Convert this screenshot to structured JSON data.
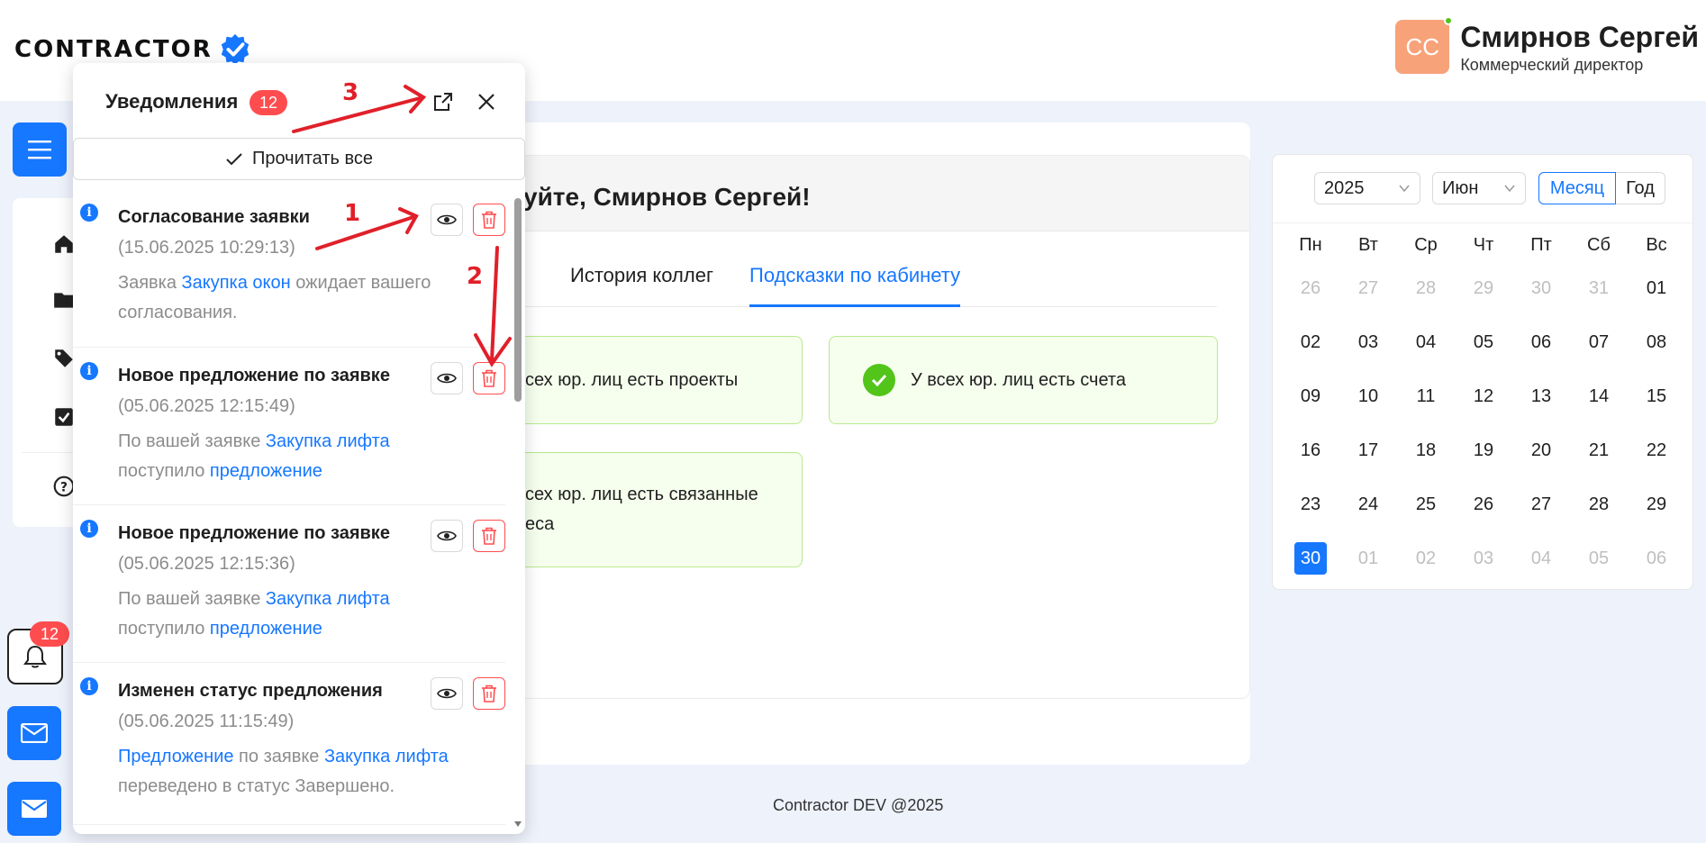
{
  "header": {
    "logo_text": "CONTRACTOR",
    "user_initials": "СС",
    "user_name": "Смирнов Сергей",
    "user_role": "Коммерческий директор"
  },
  "main": {
    "welcome_title": "уйте, Смирнов Сергей!",
    "tabs": [
      {
        "label": "История коллег",
        "active": false
      },
      {
        "label": "Подсказки по кабинету",
        "active": true
      }
    ],
    "hints": [
      {
        "text": "сех юр. лиц есть проекты"
      },
      {
        "text": "У всех юр. лиц есть счета"
      },
      {
        "text_line1": "сех юр. лиц есть связанные",
        "text_line2": "еса"
      }
    ]
  },
  "calendar": {
    "year": "2025",
    "month": "Июн",
    "mode_month": "Месяц",
    "mode_year": "Год",
    "weekdays": [
      "Пн",
      "Вт",
      "Ср",
      "Чт",
      "Пт",
      "Сб",
      "Вс"
    ],
    "weeks": [
      [
        {
          "d": "26",
          "dim": true
        },
        {
          "d": "27",
          "dim": true
        },
        {
          "d": "28",
          "dim": true
        },
        {
          "d": "29",
          "dim": true
        },
        {
          "d": "30",
          "dim": true
        },
        {
          "d": "31",
          "dim": true
        },
        {
          "d": "01",
          "dim": false
        }
      ],
      [
        {
          "d": "02",
          "dim": false
        },
        {
          "d": "03",
          "dim": false
        },
        {
          "d": "04",
          "dim": false
        },
        {
          "d": "05",
          "dim": false
        },
        {
          "d": "06",
          "dim": false
        },
        {
          "d": "07",
          "dim": false
        },
        {
          "d": "08",
          "dim": false
        }
      ],
      [
        {
          "d": "09",
          "dim": false
        },
        {
          "d": "10",
          "dim": false
        },
        {
          "d": "11",
          "dim": false
        },
        {
          "d": "12",
          "dim": false
        },
        {
          "d": "13",
          "dim": false
        },
        {
          "d": "14",
          "dim": false
        },
        {
          "d": "15",
          "dim": false
        }
      ],
      [
        {
          "d": "16",
          "dim": false
        },
        {
          "d": "17",
          "dim": false
        },
        {
          "d": "18",
          "dim": false
        },
        {
          "d": "19",
          "dim": false
        },
        {
          "d": "20",
          "dim": false
        },
        {
          "d": "21",
          "dim": false
        },
        {
          "d": "22",
          "dim": false
        }
      ],
      [
        {
          "d": "23",
          "dim": false
        },
        {
          "d": "24",
          "dim": false
        },
        {
          "d": "25",
          "dim": false
        },
        {
          "d": "26",
          "dim": false
        },
        {
          "d": "27",
          "dim": false
        },
        {
          "d": "28",
          "dim": false
        },
        {
          "d": "29",
          "dim": false
        }
      ],
      [
        {
          "d": "30",
          "dim": false,
          "today": true
        },
        {
          "d": "01",
          "dim": true
        },
        {
          "d": "02",
          "dim": true
        },
        {
          "d": "03",
          "dim": true
        },
        {
          "d": "04",
          "dim": true
        },
        {
          "d": "05",
          "dim": true
        },
        {
          "d": "06",
          "dim": true
        }
      ]
    ]
  },
  "footer": {
    "text": "Contractor DEV @2025"
  },
  "sidebar": {
    "notification_count": "12"
  },
  "notifications": {
    "title": "Уведомления",
    "count": "12",
    "read_all_label": "Прочитать все",
    "items": [
      {
        "title": "Согласование заявки",
        "date": "(15.06.2025 10:29:13)",
        "body_parts": [
          [
            "Заявка ",
            false
          ],
          [
            "Закупка окон",
            true
          ],
          [
            " ожидает вашего согласования.",
            false
          ]
        ]
      },
      {
        "title": "Новое предложение по заявке",
        "date": "(05.06.2025 12:15:49)",
        "body_parts": [
          [
            "По вашей заявке ",
            false
          ],
          [
            "Закупка лифта",
            true
          ],
          [
            " поступило ",
            false
          ],
          [
            "предложение",
            true
          ]
        ]
      },
      {
        "title": "Новое предложение по заявке",
        "date": "(05.06.2025 12:15:36)",
        "body_parts": [
          [
            "По вашей заявке ",
            false
          ],
          [
            "Закупка лифта",
            true
          ],
          [
            " поступило ",
            false
          ],
          [
            "предложение",
            true
          ]
        ]
      },
      {
        "title": "Изменен статус предложения",
        "date": "(05.06.2025 11:15:49)",
        "body_parts": [
          [
            "Предложение",
            true
          ],
          [
            " по заявке ",
            false
          ],
          [
            "Закупка лифта",
            true
          ],
          [
            " переведено в статус Завершено.",
            false
          ]
        ]
      }
    ]
  },
  "annotations": {
    "a1": "1",
    "a2": "2",
    "a3": "3"
  },
  "colors": {
    "accent": "#1677ff",
    "danger": "#ff4d4f",
    "success": "#52c41a",
    "annotation": "#e0202a"
  }
}
